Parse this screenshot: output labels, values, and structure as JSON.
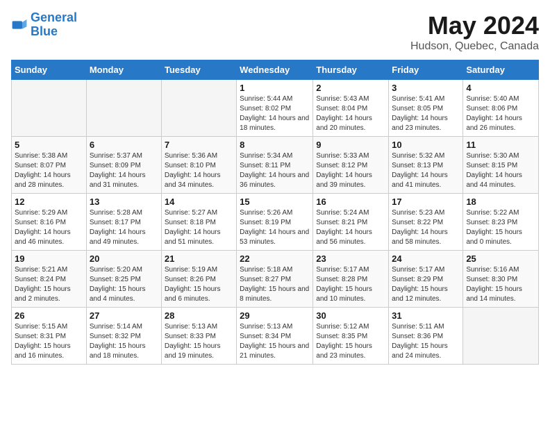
{
  "app": {
    "name": "GeneralBlue",
    "logo_text_line1": "General",
    "logo_text_line2": "Blue"
  },
  "calendar": {
    "title": "May 2024",
    "subtitle": "Hudson, Quebec, Canada",
    "days_of_week": [
      "Sunday",
      "Monday",
      "Tuesday",
      "Wednesday",
      "Thursday",
      "Friday",
      "Saturday"
    ],
    "weeks": [
      [
        {
          "day": "",
          "info": ""
        },
        {
          "day": "",
          "info": ""
        },
        {
          "day": "",
          "info": ""
        },
        {
          "day": "1",
          "info": "Sunrise: 5:44 AM\nSunset: 8:02 PM\nDaylight: 14 hours and 18 minutes."
        },
        {
          "day": "2",
          "info": "Sunrise: 5:43 AM\nSunset: 8:04 PM\nDaylight: 14 hours and 20 minutes."
        },
        {
          "day": "3",
          "info": "Sunrise: 5:41 AM\nSunset: 8:05 PM\nDaylight: 14 hours and 23 minutes."
        },
        {
          "day": "4",
          "info": "Sunrise: 5:40 AM\nSunset: 8:06 PM\nDaylight: 14 hours and 26 minutes."
        }
      ],
      [
        {
          "day": "5",
          "info": "Sunrise: 5:38 AM\nSunset: 8:07 PM\nDaylight: 14 hours and 28 minutes."
        },
        {
          "day": "6",
          "info": "Sunrise: 5:37 AM\nSunset: 8:09 PM\nDaylight: 14 hours and 31 minutes."
        },
        {
          "day": "7",
          "info": "Sunrise: 5:36 AM\nSunset: 8:10 PM\nDaylight: 14 hours and 34 minutes."
        },
        {
          "day": "8",
          "info": "Sunrise: 5:34 AM\nSunset: 8:11 PM\nDaylight: 14 hours and 36 minutes."
        },
        {
          "day": "9",
          "info": "Sunrise: 5:33 AM\nSunset: 8:12 PM\nDaylight: 14 hours and 39 minutes."
        },
        {
          "day": "10",
          "info": "Sunrise: 5:32 AM\nSunset: 8:13 PM\nDaylight: 14 hours and 41 minutes."
        },
        {
          "day": "11",
          "info": "Sunrise: 5:30 AM\nSunset: 8:15 PM\nDaylight: 14 hours and 44 minutes."
        }
      ],
      [
        {
          "day": "12",
          "info": "Sunrise: 5:29 AM\nSunset: 8:16 PM\nDaylight: 14 hours and 46 minutes."
        },
        {
          "day": "13",
          "info": "Sunrise: 5:28 AM\nSunset: 8:17 PM\nDaylight: 14 hours and 49 minutes."
        },
        {
          "day": "14",
          "info": "Sunrise: 5:27 AM\nSunset: 8:18 PM\nDaylight: 14 hours and 51 minutes."
        },
        {
          "day": "15",
          "info": "Sunrise: 5:26 AM\nSunset: 8:19 PM\nDaylight: 14 hours and 53 minutes."
        },
        {
          "day": "16",
          "info": "Sunrise: 5:24 AM\nSunset: 8:21 PM\nDaylight: 14 hours and 56 minutes."
        },
        {
          "day": "17",
          "info": "Sunrise: 5:23 AM\nSunset: 8:22 PM\nDaylight: 14 hours and 58 minutes."
        },
        {
          "day": "18",
          "info": "Sunrise: 5:22 AM\nSunset: 8:23 PM\nDaylight: 15 hours and 0 minutes."
        }
      ],
      [
        {
          "day": "19",
          "info": "Sunrise: 5:21 AM\nSunset: 8:24 PM\nDaylight: 15 hours and 2 minutes."
        },
        {
          "day": "20",
          "info": "Sunrise: 5:20 AM\nSunset: 8:25 PM\nDaylight: 15 hours and 4 minutes."
        },
        {
          "day": "21",
          "info": "Sunrise: 5:19 AM\nSunset: 8:26 PM\nDaylight: 15 hours and 6 minutes."
        },
        {
          "day": "22",
          "info": "Sunrise: 5:18 AM\nSunset: 8:27 PM\nDaylight: 15 hours and 8 minutes."
        },
        {
          "day": "23",
          "info": "Sunrise: 5:17 AM\nSunset: 8:28 PM\nDaylight: 15 hours and 10 minutes."
        },
        {
          "day": "24",
          "info": "Sunrise: 5:17 AM\nSunset: 8:29 PM\nDaylight: 15 hours and 12 minutes."
        },
        {
          "day": "25",
          "info": "Sunrise: 5:16 AM\nSunset: 8:30 PM\nDaylight: 15 hours and 14 minutes."
        }
      ],
      [
        {
          "day": "26",
          "info": "Sunrise: 5:15 AM\nSunset: 8:31 PM\nDaylight: 15 hours and 16 minutes."
        },
        {
          "day": "27",
          "info": "Sunrise: 5:14 AM\nSunset: 8:32 PM\nDaylight: 15 hours and 18 minutes."
        },
        {
          "day": "28",
          "info": "Sunrise: 5:13 AM\nSunset: 8:33 PM\nDaylight: 15 hours and 19 minutes."
        },
        {
          "day": "29",
          "info": "Sunrise: 5:13 AM\nSunset: 8:34 PM\nDaylight: 15 hours and 21 minutes."
        },
        {
          "day": "30",
          "info": "Sunrise: 5:12 AM\nSunset: 8:35 PM\nDaylight: 15 hours and 23 minutes."
        },
        {
          "day": "31",
          "info": "Sunrise: 5:11 AM\nSunset: 8:36 PM\nDaylight: 15 hours and 24 minutes."
        },
        {
          "day": "",
          "info": ""
        }
      ]
    ]
  }
}
